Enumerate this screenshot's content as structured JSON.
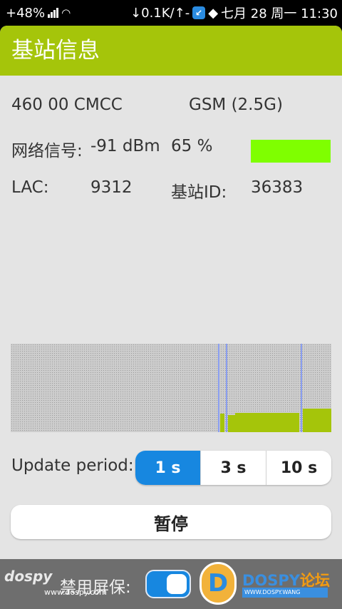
{
  "status_bar": {
    "battery": "+48%",
    "network_speed": "↓0.1K/↑-",
    "clock": "七月 28 周一 11:30",
    "icons": [
      "signal-icon",
      "wifi-icon",
      "app-badge-icon",
      "bird-icon"
    ]
  },
  "title": "基站信息",
  "info": {
    "operator": "460 00 CMCC",
    "network_type": "GSM (2.5G)",
    "signal_label": "网络信号:",
    "signal_dbm": "-91 dBm",
    "signal_percent": "65 %",
    "signal_level": 0.65,
    "lac_label": "LAC:",
    "lac_value": "9312",
    "cell_id_label": "基站ID:",
    "cell_id_value": "36383"
  },
  "graph": {
    "bar_color": "#a5c50a",
    "marker_color": "#8a9ef0"
  },
  "update_period": {
    "label": "Update period:",
    "options": [
      "1 s",
      "3 s",
      "10 s"
    ],
    "selected": "1 s"
  },
  "pause_button": "暂停",
  "bottom": {
    "keep_screen_on_label": "禁用屏保:",
    "keep_screen_on": true
  },
  "watermarks": {
    "left_mark": "dospy",
    "left_url": "www.dospy.com",
    "brand": "DOSPY",
    "brand_cn": "论坛",
    "brand_sub": "WWW.DOSPY.WANG"
  },
  "colors": {
    "title_bar": "#a5c50a",
    "signal_bar": "#7fff00",
    "accent": "#1787e0"
  }
}
